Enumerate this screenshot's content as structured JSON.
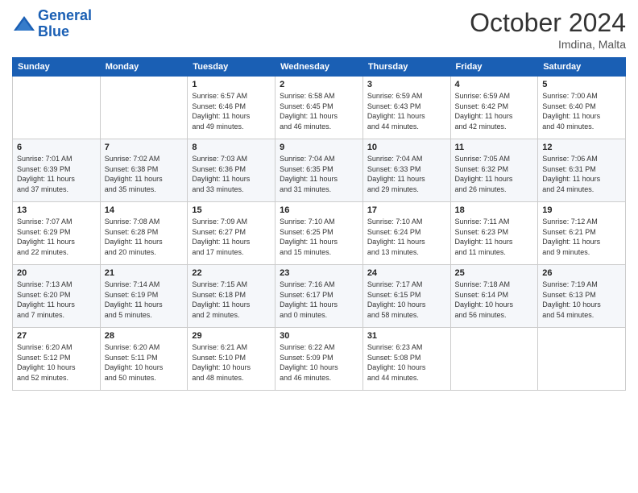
{
  "header": {
    "logo_line1": "General",
    "logo_line2": "Blue",
    "month_title": "October 2024",
    "location": "Imdina, Malta"
  },
  "weekdays": [
    "Sunday",
    "Monday",
    "Tuesday",
    "Wednesday",
    "Thursday",
    "Friday",
    "Saturday"
  ],
  "weeks": [
    [
      {
        "day": "",
        "detail": ""
      },
      {
        "day": "",
        "detail": ""
      },
      {
        "day": "1",
        "detail": "Sunrise: 6:57 AM\nSunset: 6:46 PM\nDaylight: 11 hours\nand 49 minutes."
      },
      {
        "day": "2",
        "detail": "Sunrise: 6:58 AM\nSunset: 6:45 PM\nDaylight: 11 hours\nand 46 minutes."
      },
      {
        "day": "3",
        "detail": "Sunrise: 6:59 AM\nSunset: 6:43 PM\nDaylight: 11 hours\nand 44 minutes."
      },
      {
        "day": "4",
        "detail": "Sunrise: 6:59 AM\nSunset: 6:42 PM\nDaylight: 11 hours\nand 42 minutes."
      },
      {
        "day": "5",
        "detail": "Sunrise: 7:00 AM\nSunset: 6:40 PM\nDaylight: 11 hours\nand 40 minutes."
      }
    ],
    [
      {
        "day": "6",
        "detail": "Sunrise: 7:01 AM\nSunset: 6:39 PM\nDaylight: 11 hours\nand 37 minutes."
      },
      {
        "day": "7",
        "detail": "Sunrise: 7:02 AM\nSunset: 6:38 PM\nDaylight: 11 hours\nand 35 minutes."
      },
      {
        "day": "8",
        "detail": "Sunrise: 7:03 AM\nSunset: 6:36 PM\nDaylight: 11 hours\nand 33 minutes."
      },
      {
        "day": "9",
        "detail": "Sunrise: 7:04 AM\nSunset: 6:35 PM\nDaylight: 11 hours\nand 31 minutes."
      },
      {
        "day": "10",
        "detail": "Sunrise: 7:04 AM\nSunset: 6:33 PM\nDaylight: 11 hours\nand 29 minutes."
      },
      {
        "day": "11",
        "detail": "Sunrise: 7:05 AM\nSunset: 6:32 PM\nDaylight: 11 hours\nand 26 minutes."
      },
      {
        "day": "12",
        "detail": "Sunrise: 7:06 AM\nSunset: 6:31 PM\nDaylight: 11 hours\nand 24 minutes."
      }
    ],
    [
      {
        "day": "13",
        "detail": "Sunrise: 7:07 AM\nSunset: 6:29 PM\nDaylight: 11 hours\nand 22 minutes."
      },
      {
        "day": "14",
        "detail": "Sunrise: 7:08 AM\nSunset: 6:28 PM\nDaylight: 11 hours\nand 20 minutes."
      },
      {
        "day": "15",
        "detail": "Sunrise: 7:09 AM\nSunset: 6:27 PM\nDaylight: 11 hours\nand 17 minutes."
      },
      {
        "day": "16",
        "detail": "Sunrise: 7:10 AM\nSunset: 6:25 PM\nDaylight: 11 hours\nand 15 minutes."
      },
      {
        "day": "17",
        "detail": "Sunrise: 7:10 AM\nSunset: 6:24 PM\nDaylight: 11 hours\nand 13 minutes."
      },
      {
        "day": "18",
        "detail": "Sunrise: 7:11 AM\nSunset: 6:23 PM\nDaylight: 11 hours\nand 11 minutes."
      },
      {
        "day": "19",
        "detail": "Sunrise: 7:12 AM\nSunset: 6:21 PM\nDaylight: 11 hours\nand 9 minutes."
      }
    ],
    [
      {
        "day": "20",
        "detail": "Sunrise: 7:13 AM\nSunset: 6:20 PM\nDaylight: 11 hours\nand 7 minutes."
      },
      {
        "day": "21",
        "detail": "Sunrise: 7:14 AM\nSunset: 6:19 PM\nDaylight: 11 hours\nand 5 minutes."
      },
      {
        "day": "22",
        "detail": "Sunrise: 7:15 AM\nSunset: 6:18 PM\nDaylight: 11 hours\nand 2 minutes."
      },
      {
        "day": "23",
        "detail": "Sunrise: 7:16 AM\nSunset: 6:17 PM\nDaylight: 11 hours\nand 0 minutes."
      },
      {
        "day": "24",
        "detail": "Sunrise: 7:17 AM\nSunset: 6:15 PM\nDaylight: 10 hours\nand 58 minutes."
      },
      {
        "day": "25",
        "detail": "Sunrise: 7:18 AM\nSunset: 6:14 PM\nDaylight: 10 hours\nand 56 minutes."
      },
      {
        "day": "26",
        "detail": "Sunrise: 7:19 AM\nSunset: 6:13 PM\nDaylight: 10 hours\nand 54 minutes."
      }
    ],
    [
      {
        "day": "27",
        "detail": "Sunrise: 6:20 AM\nSunset: 5:12 PM\nDaylight: 10 hours\nand 52 minutes."
      },
      {
        "day": "28",
        "detail": "Sunrise: 6:20 AM\nSunset: 5:11 PM\nDaylight: 10 hours\nand 50 minutes."
      },
      {
        "day": "29",
        "detail": "Sunrise: 6:21 AM\nSunset: 5:10 PM\nDaylight: 10 hours\nand 48 minutes."
      },
      {
        "day": "30",
        "detail": "Sunrise: 6:22 AM\nSunset: 5:09 PM\nDaylight: 10 hours\nand 46 minutes."
      },
      {
        "day": "31",
        "detail": "Sunrise: 6:23 AM\nSunset: 5:08 PM\nDaylight: 10 hours\nand 44 minutes."
      },
      {
        "day": "",
        "detail": ""
      },
      {
        "day": "",
        "detail": ""
      }
    ]
  ]
}
